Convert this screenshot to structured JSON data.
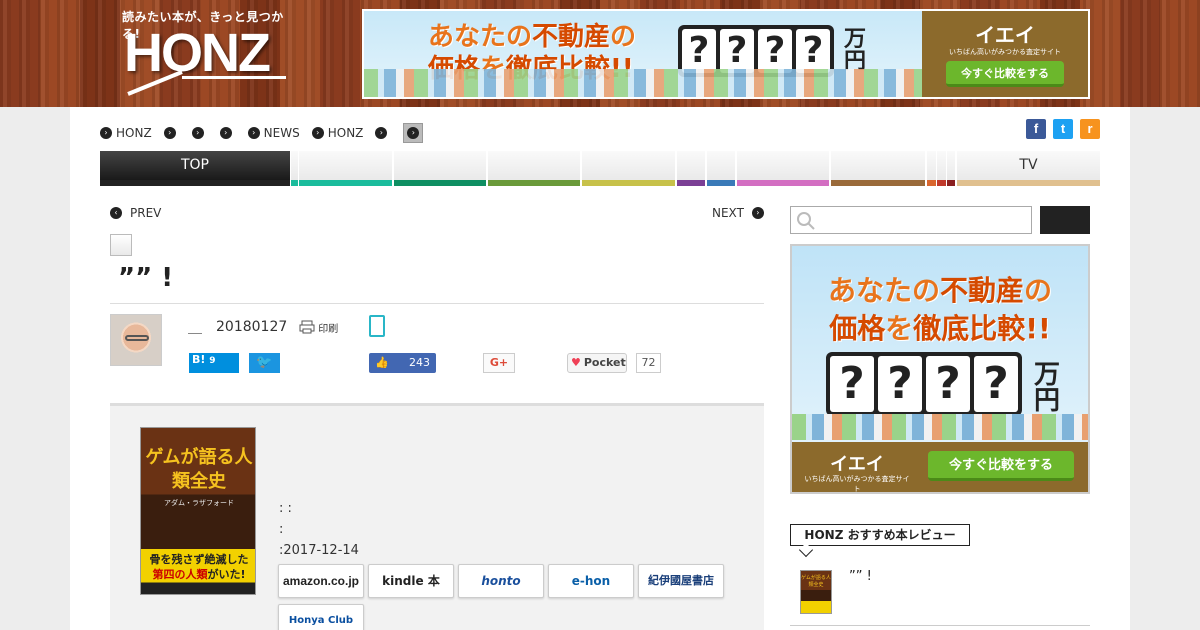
{
  "header": {
    "tagline": "読みたい本が、きっと見つかる!",
    "logo": "HONZ",
    "ad": {
      "copy_line1_a": "あなたの",
      "copy_line1_b": "不動産",
      "copy_line1_c": "の",
      "copy_line2_a": "価格",
      "copy_line2_b": "を",
      "copy_line2_c": "徹底比較!!",
      "marks": [
        "?",
        "?",
        "?",
        "?"
      ],
      "unit": "万円",
      "brand": "イエイ",
      "brand_sub": "いちばん高いがみつかる査定サイト",
      "cta": "今すぐ比較をする"
    }
  },
  "breadcrumb": {
    "items": [
      "HONZ",
      "",
      "",
      "",
      "NEWS",
      "HONZ",
      "",
      ""
    ]
  },
  "social": {
    "facebook": "f",
    "twitter": "t",
    "rss": "r"
  },
  "tabs": [
    {
      "label": "TOP",
      "color": "#222222"
    },
    {
      "label": "",
      "color": "#1abc9c"
    },
    {
      "label": "",
      "color": "#1abc9c"
    },
    {
      "label": "",
      "color": "#0e8f62"
    },
    {
      "label": "",
      "color": "#6a9a3a"
    },
    {
      "label": "",
      "color": "#c7c14a"
    },
    {
      "label": "",
      "color": "#7b3f95"
    },
    {
      "label": "",
      "color": "#3a7ab8"
    },
    {
      "label": "",
      "color": "#d36ec2"
    },
    {
      "label": "",
      "color": "#9a6a3a"
    },
    {
      "label": "",
      "color": "#d9662e"
    },
    {
      "label": "",
      "color": "#c0392b"
    },
    {
      "label": "",
      "color": "#8a1f1f"
    },
    {
      "label": "TV",
      "color": "#e0c08f"
    }
  ],
  "article": {
    "prev": "PREV",
    "next": "NEXT",
    "title": "”” !",
    "author": "＿",
    "date": "20180127",
    "print_label": "印刷",
    "hatena": "B!",
    "hatena_count": "9",
    "like_count": "243",
    "gplus": "G+",
    "pocket": "Pocket",
    "pocket_count": "72"
  },
  "book": {
    "cover_title": "ゲムが語る人類全史",
    "cover_author": "アダム・ラザフォード",
    "cover_band_1": "骨を残さず絶滅した",
    "cover_band_2": "第四の人類",
    "cover_band_3": "がいた!",
    "info_line1": ": :",
    "info_line2": ":",
    "info_line3": ":2017-12-14",
    "stores": [
      "amazon.co.jp",
      "kindle 本",
      "honto",
      "e-hon",
      "紀伊國屋書店",
      "Honya Club"
    ]
  },
  "sidebar": {
    "heading": "HONZ おすすめ本レビュー",
    "item_title": "”” !"
  }
}
